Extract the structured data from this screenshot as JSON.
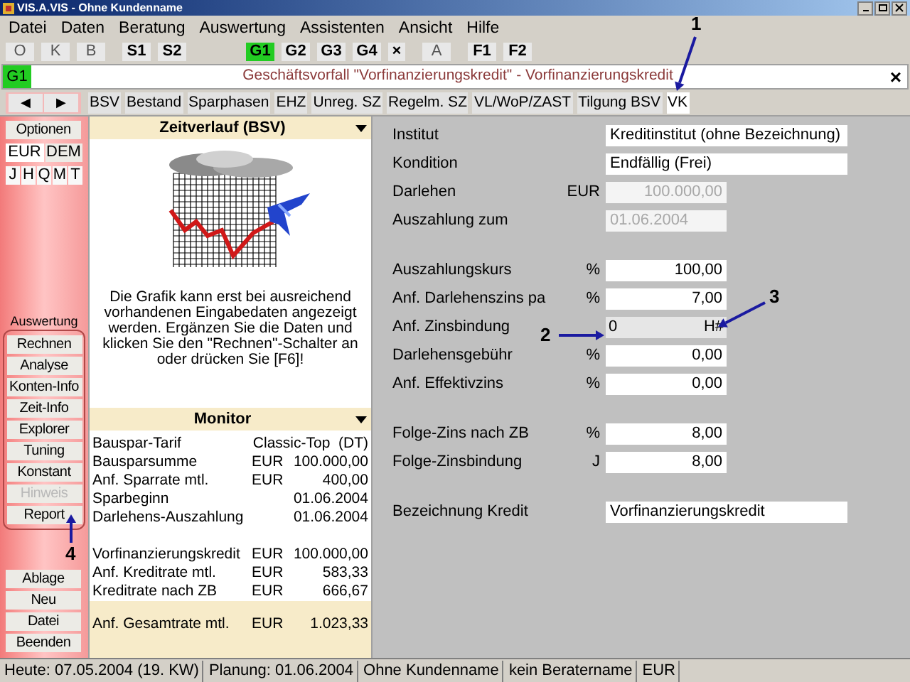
{
  "window": {
    "title": "VIS.A.VIS - Ohne Kundenname"
  },
  "menu": [
    "Datei",
    "Daten",
    "Beratung",
    "Auswertung",
    "Assistenten",
    "Ansicht",
    "Hilfe"
  ],
  "toolbar": {
    "groups": [
      [
        {
          "label": "O",
          "kind": "mode",
          "selected": false
        },
        {
          "label": "K",
          "kind": "mode",
          "selected": false
        },
        {
          "label": "B",
          "kind": "mode",
          "selected": false
        }
      ],
      [
        {
          "label": "S1",
          "kind": "plan",
          "selected": false
        },
        {
          "label": "S2",
          "kind": "plan",
          "selected": false
        }
      ],
      [
        {
          "label": "G1",
          "kind": "plan",
          "selected": true
        },
        {
          "label": "G2",
          "kind": "plan",
          "selected": false
        },
        {
          "label": "G3",
          "kind": "plan",
          "selected": false
        },
        {
          "label": "G4",
          "kind": "plan",
          "selected": false
        },
        {
          "label": "×",
          "kind": "close",
          "selected": false
        }
      ],
      [
        {
          "label": "A",
          "kind": "mode",
          "selected": false
        }
      ],
      [
        {
          "label": "F1",
          "kind": "plan",
          "selected": false
        },
        {
          "label": "F2",
          "kind": "plan",
          "selected": false
        }
      ]
    ]
  },
  "case_bar": {
    "badge": "G1",
    "title": "Geschäftsvorfall \"Vorfinanzierungskredit\" - Vorfinanzierungskredit",
    "close": "×"
  },
  "nav": {
    "prev": "◀",
    "next": "▶"
  },
  "tabs": [
    {
      "label": "BSV",
      "selected": false
    },
    {
      "label": "Bestand",
      "selected": false
    },
    {
      "label": "Sparphasen",
      "selected": false
    },
    {
      "label": "EHZ",
      "selected": false
    },
    {
      "label": "Unreg. SZ",
      "selected": false
    },
    {
      "label": "Regelm. SZ",
      "selected": false
    },
    {
      "label": "VL/WoP/ZAST",
      "selected": false
    },
    {
      "label": "Tilgung BSV",
      "selected": false
    },
    {
      "label": "VK",
      "selected": true
    }
  ],
  "sidebar": {
    "options": "Optionen",
    "currencies": [
      {
        "label": "EUR",
        "selected": true
      },
      {
        "label": "DEM",
        "selected": false
      }
    ],
    "periods": [
      "J",
      "H",
      "Q",
      "M",
      "T"
    ],
    "group_label": "Auswertung",
    "actions": [
      {
        "label": "Rechnen",
        "disabled": false
      },
      {
        "label": "Analyse",
        "disabled": false
      },
      {
        "label": "Konten-Info",
        "disabled": false
      },
      {
        "label": "Zeit-Info",
        "disabled": false
      },
      {
        "label": "Explorer",
        "disabled": false
      },
      {
        "label": "Tuning",
        "disabled": false
      },
      {
        "label": "Konstant",
        "disabled": false
      },
      {
        "label": "Hinweis",
        "disabled": true
      },
      {
        "label": "Report",
        "disabled": false
      }
    ],
    "bottom": [
      "Ablage",
      "Neu",
      "Datei",
      "Beenden"
    ]
  },
  "timeline": {
    "title": "Zeitverlauf (BSV)",
    "message": "Die Grafik kann erst bei ausreichend vorhandenen Eingabedaten angezeigt werden. Ergänzen Sie die Daten und klicken Sie den \"Rechnen\"-Schalter an oder drücken Sie [F6]!"
  },
  "monitor": {
    "title": "Monitor",
    "sections": [
      [
        {
          "label": "Bauspar-Tarif",
          "value": "Classic-Top  (DT)"
        },
        {
          "label": "Bausparsumme",
          "unit": "EUR",
          "value": "100.000,00"
        },
        {
          "label": "Anf. Sparrate mtl.",
          "unit": "EUR",
          "value": "400,00"
        },
        {
          "label": "Sparbeginn",
          "value": "01.06.2004"
        },
        {
          "label": "Darlehens-Auszahlung",
          "value": "01.06.2004"
        }
      ],
      [
        {
          "label": "Vorfinanzierungskredit",
          "unit": "EUR",
          "value": "100.000,00"
        },
        {
          "label": "Anf. Kreditrate mtl.",
          "unit": "EUR",
          "value": "583,33"
        },
        {
          "label": "Kreditrate nach ZB",
          "unit": "EUR",
          "value": "666,67"
        }
      ]
    ],
    "total": {
      "label": "Anf. Gesamtrate mtl.",
      "unit": "EUR",
      "value": "1.023,33"
    }
  },
  "form": {
    "sections": [
      [
        {
          "label": "Institut",
          "kind": "text",
          "value": "Kreditinstitut (ohne Bezeichnung)",
          "disabled": false
        },
        {
          "label": "Kondition",
          "kind": "text",
          "value": "Endfällig  (Frei)",
          "disabled": false
        },
        {
          "label": "Darlehen",
          "unit": "EUR",
          "kind": "number",
          "value": "100.000,00",
          "disabled": true
        },
        {
          "label": "Auszahlung zum",
          "kind": "date",
          "value": "01.06.2004",
          "disabled": true
        }
      ],
      [
        {
          "label": "Auszahlungskurs",
          "unit": "%",
          "kind": "number",
          "value": "100,00",
          "disabled": false
        },
        {
          "label": "Anf. Darlehenszins pa",
          "unit": "%",
          "kind": "number",
          "value": "7,00",
          "disabled": false
        },
        {
          "label": "Anf. Zinsbindung",
          "kind": "pair",
          "value": "0",
          "suffix": "H#",
          "disabled": false
        },
        {
          "label": "Darlehensgebühr",
          "unit": "%",
          "kind": "number",
          "value": "0,00",
          "disabled": false
        },
        {
          "label": "Anf. Effektivzins",
          "unit": "%",
          "kind": "number",
          "value": "0,00",
          "disabled": false
        }
      ],
      [
        {
          "label": "Folge-Zins nach ZB",
          "unit": "%",
          "kind": "number",
          "value": "8,00",
          "disabled": false
        },
        {
          "label": "Folge-Zinsbindung",
          "unit": "J",
          "kind": "number",
          "value": "8,00",
          "disabled": false
        }
      ],
      [
        {
          "label": "Bezeichnung Kredit",
          "kind": "text",
          "value": "Vorfinanzierungskredit",
          "disabled": false
        }
      ]
    ]
  },
  "status_bar": [
    "Heute: 07.05.2004 (19. KW)",
    "Planung: 01.06.2004",
    "Ohne Kundenname",
    "kein Beratername",
    "EUR"
  ],
  "annotations": [
    {
      "label": "1"
    },
    {
      "label": "2"
    },
    {
      "label": "3"
    },
    {
      "label": "4"
    }
  ]
}
